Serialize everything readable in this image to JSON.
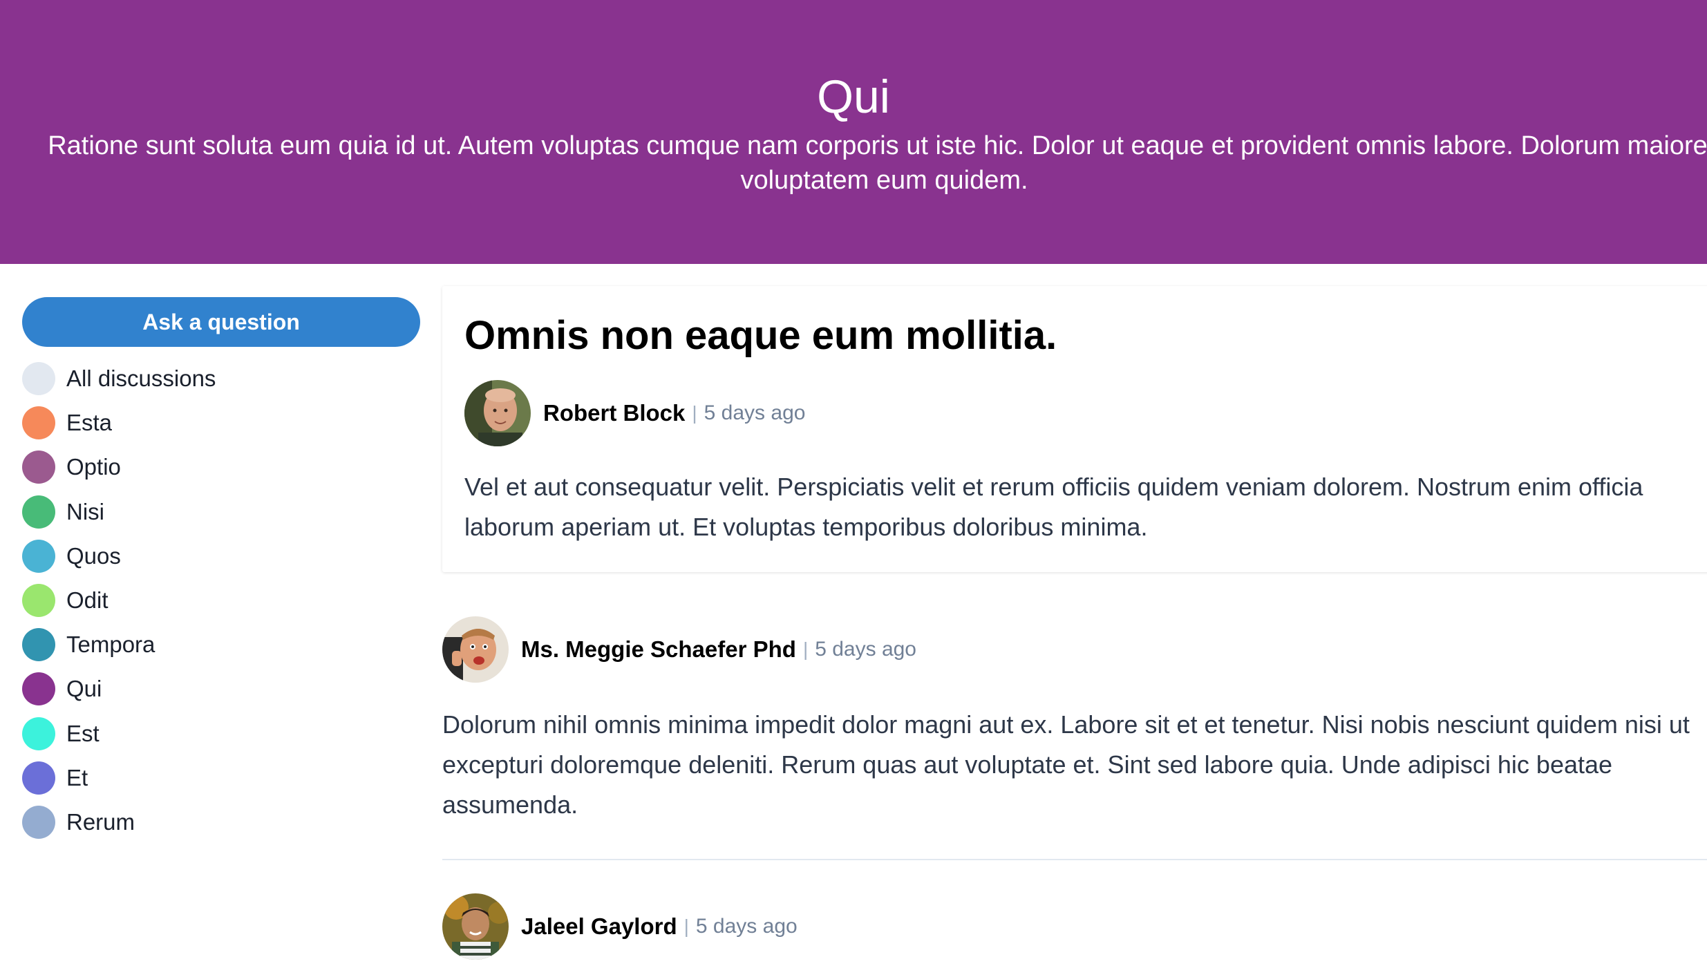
{
  "header": {
    "title": "Qui",
    "description": "Ratione sunt soluta eum quia id ut. Autem voluptas cumque nam corporis ut iste hic. Dolor ut eaque et provident omnis labore. Dolorum maiores voluptatem eum quidem.",
    "background_color": "#89338f"
  },
  "sidebar": {
    "ask_button_label": "Ask a question",
    "channels": [
      {
        "label": "All discussions",
        "color": "#e2e8f0"
      },
      {
        "label": "Esta",
        "color": "#f6895a"
      },
      {
        "label": "Optio",
        "color": "#9b5a8f"
      },
      {
        "label": "Nisi",
        "color": "#48bb78"
      },
      {
        "label": "Quos",
        "color": "#4ab3d4"
      },
      {
        "label": "Odit",
        "color": "#9ae66e"
      },
      {
        "label": "Tempora",
        "color": "#3194b0"
      },
      {
        "label": "Qui",
        "color": "#89338f"
      },
      {
        "label": "Est",
        "color": "#3cf2dc"
      },
      {
        "label": "Et",
        "color": "#6b6fd8"
      },
      {
        "label": "Rerum",
        "color": "#94acd0"
      }
    ]
  },
  "thread": {
    "title": "Omnis non eaque eum mollitia.",
    "author": "Robert Block",
    "separator": "|",
    "time": "5 days ago",
    "body": "Vel et aut consequatur velit. Perspiciatis velit et rerum officiis quidem veniam dolorem. Nostrum enim officia laborum aperiam ut. Et voluptas temporibus doloribus minima."
  },
  "replies": [
    {
      "author": "Ms. Meggie Schaefer Phd",
      "separator": "|",
      "time": "5 days ago",
      "body": "Dolorum nihil omnis minima impedit dolor magni aut ex. Labore sit et et tenetur. Nisi nobis nesciunt quidem nisi ut excepturi doloremque deleniti. Rerum quas aut voluptate et. Sint sed labore quia. Unde adipisci hic beatae assumenda."
    },
    {
      "author": "Jaleel Gaylord",
      "separator": "|",
      "time": "5 days ago"
    }
  ]
}
